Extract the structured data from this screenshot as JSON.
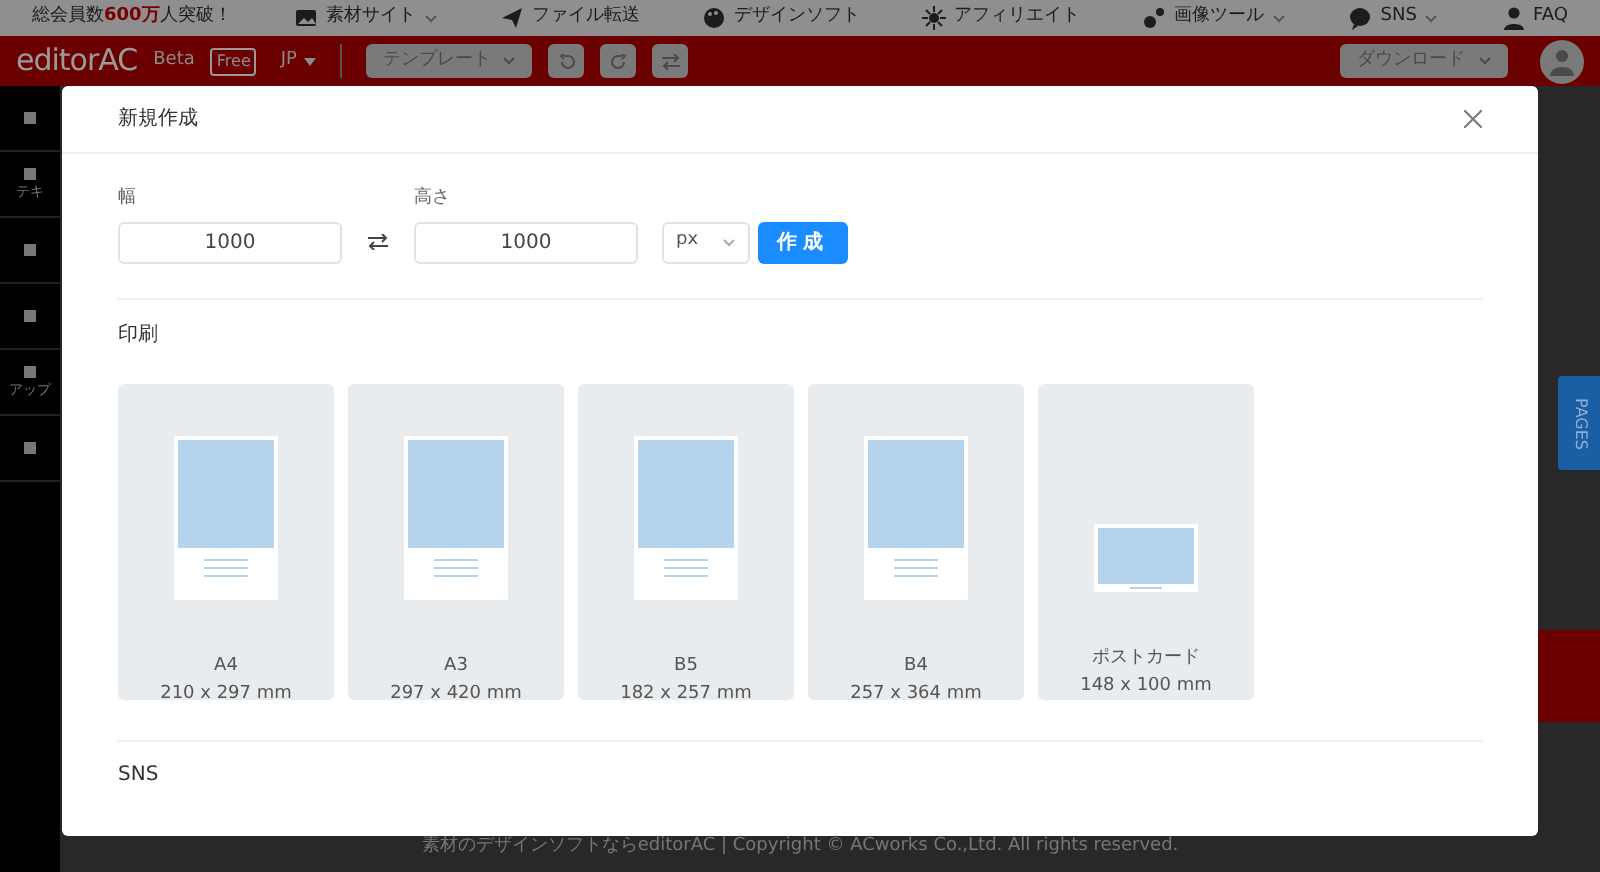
{
  "top_bar": {
    "notice": [
      {
        "text": "総会員数",
        "highlight": false
      },
      {
        "text": "600万",
        "highlight": true
      },
      {
        "text": "人突破！",
        "highlight": false
      }
    ],
    "links": [
      {
        "label": "素材サイト",
        "dropdown": true
      },
      {
        "label": "ファイル転送",
        "dropdown": false
      },
      {
        "label": "デザインソフト",
        "dropdown": false
      },
      {
        "label": "アフィリエイト",
        "dropdown": false
      },
      {
        "label": "画像ツール",
        "dropdown": true
      },
      {
        "label": "SNS",
        "dropdown": true
      },
      {
        "label": "FAQ",
        "dropdown": false
      }
    ]
  },
  "toolbar": {
    "logo": "editorAC",
    "beta": "Beta",
    "free": "Free",
    "language": "JP",
    "template_button": "テンプレート",
    "download_button": "ダウンロード"
  },
  "sidebar": {
    "items": [
      {
        "kind": "tool"
      },
      {
        "kind": "tool",
        "label": "テキ"
      },
      {
        "kind": "tool"
      },
      {
        "kind": "tool"
      },
      {
        "kind": "tool",
        "label": "アップ"
      },
      {
        "kind": "tool"
      }
    ]
  },
  "side_tab": "PAGES",
  "footer": "素材のデザインソフトならeditorAC | Copyright © ACworks Co.,Ltd. All rights reserved.",
  "modal": {
    "title": "新規作成",
    "width_label": "幅",
    "width_value": "1000",
    "height_label": "高さ",
    "height_value": "1000",
    "unit": "px",
    "create_button": "作成",
    "sections": [
      {
        "title": "印刷",
        "presets": [
          {
            "name": "A4",
            "size": "210 x 297 mm",
            "kind": "portrait"
          },
          {
            "name": "A3",
            "size": "297 x 420 mm",
            "kind": "portrait"
          },
          {
            "name": "B5",
            "size": "182 x 257 mm",
            "kind": "portrait"
          },
          {
            "name": "B4",
            "size": "257 x 364 mm",
            "kind": "portrait"
          },
          {
            "name": "ポストカード",
            "size": "148 x 100 mm",
            "kind": "landscape"
          }
        ]
      },
      {
        "title": "SNS"
      }
    ]
  }
}
